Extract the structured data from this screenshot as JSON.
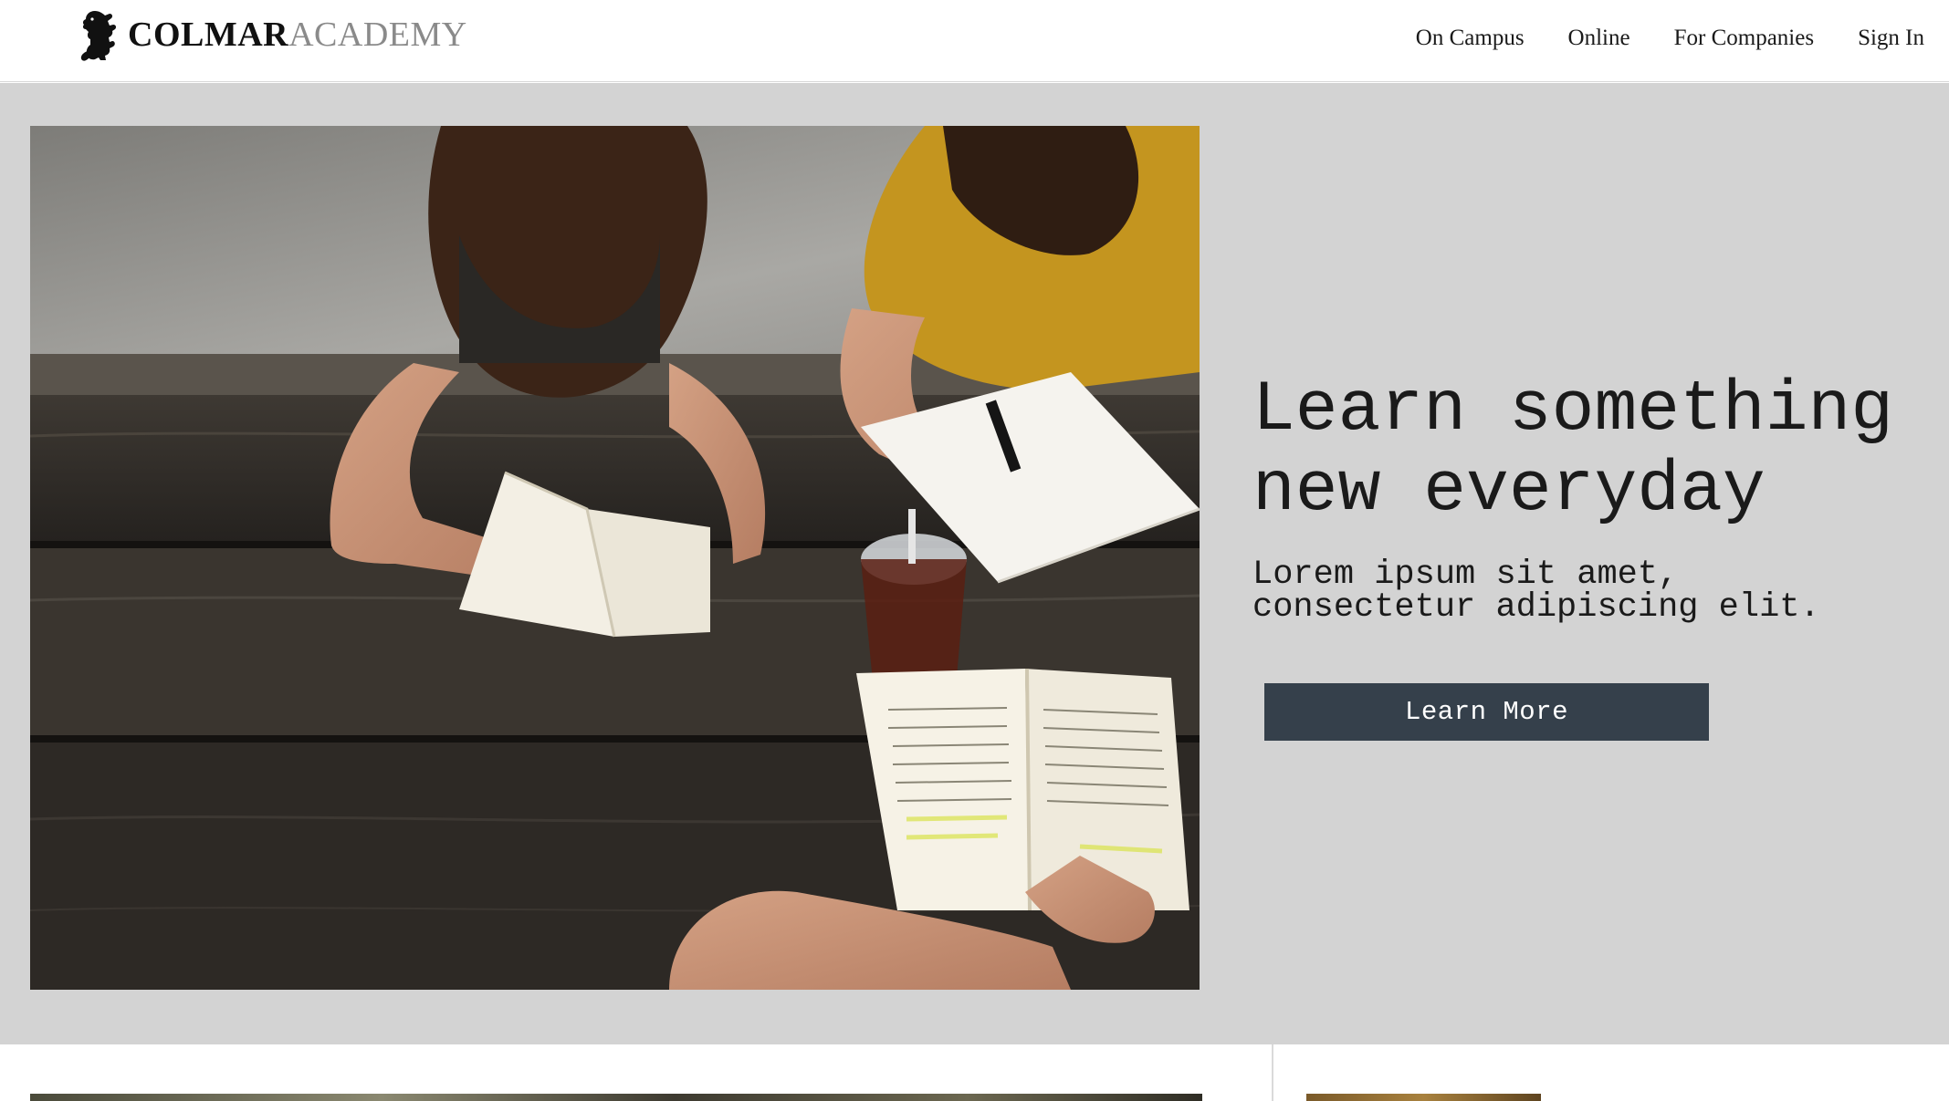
{
  "header": {
    "logo_strong": "COLMAR",
    "logo_light": "ACADEMY",
    "logo_icon": "rearing-lion-icon",
    "nav": [
      {
        "label": "On Campus"
      },
      {
        "label": "Online"
      },
      {
        "label": "For Companies"
      },
      {
        "label": "Sign In"
      }
    ]
  },
  "hero": {
    "title_line1": "Learn something",
    "title_line2": "new everyday",
    "subtitle_line1": "Lorem ipsum sit amet,",
    "subtitle_line2": "consectetur adipiscing elit.",
    "button_label": "Learn More",
    "photo_subject": "students-reading-at-picnic-table"
  },
  "colors": {
    "hero_background": "#d3d3d3",
    "button_background": "#35404b",
    "button_text": "#ffffff",
    "logo_light_text": "#8a8a8a",
    "text": "#1a1a1a"
  }
}
